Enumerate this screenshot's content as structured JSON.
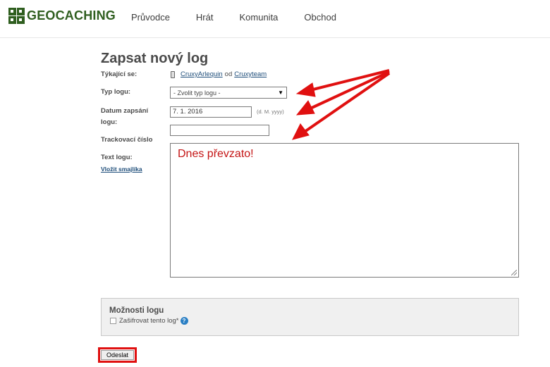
{
  "header": {
    "logo_text": "GEOCACHING",
    "logo_icon": "geocaching-logo-icon",
    "nav": [
      {
        "label": "Průvodce"
      },
      {
        "label": "Hrát"
      },
      {
        "label": "Komunita"
      },
      {
        "label": "Obchod"
      }
    ]
  },
  "form": {
    "title": "Zapsat nový log",
    "regarding_label": "Týkající se:",
    "regarding_item": "CruxyArlequin",
    "regarding_separator": "od",
    "regarding_owner": "Cruxyteam",
    "log_type_label": "Typ logu:",
    "log_type_value": "- Zvolit typ logu -",
    "date_label_line1": "Datum zapsání",
    "date_label_line2": "logu:",
    "date_value": "7. 1. 2016",
    "date_hint": "(d. M. yyyy)",
    "tracking_label": "Trackovací číslo",
    "tracking_value": "",
    "text_label": "Text logu:",
    "smiley_link": "Vložit smajlíka",
    "text_value": "Dnes převzato!"
  },
  "options": {
    "title": "Možnosti logu",
    "encrypt_label": "Zašifrovat tento log*",
    "encrypt_checked": false
  },
  "submit": {
    "label": "Odeslat"
  },
  "colors": {
    "brand": "#2f5e1f",
    "annotation_red": "#e01010",
    "link": "#1f4e7a",
    "text_red": "#c41414"
  }
}
